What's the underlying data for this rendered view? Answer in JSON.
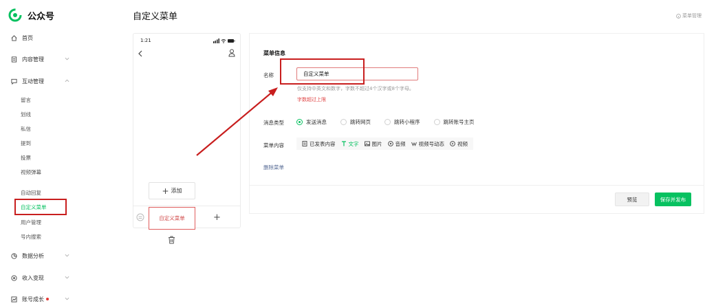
{
  "brand": {
    "name": "公众号",
    "logo_icon": "wechat-official-account-logo"
  },
  "sidebar": {
    "top_items": [
      {
        "label": "首页",
        "icon": "home-icon"
      },
      {
        "label": "内容管理",
        "icon": "document-icon"
      },
      {
        "label": "互动管理",
        "icon": "chat-icon"
      },
      {
        "label": "数据分析",
        "icon": "chart-icon"
      },
      {
        "label": "收入变现",
        "icon": "coin-icon"
      },
      {
        "label": "账号成长",
        "icon": "growth-icon"
      }
    ],
    "interaction_sub_items": [
      "留言",
      "划线",
      "私信",
      "提到",
      "投票",
      "视频弹幕"
    ],
    "service_sub_items": [
      "自动回复",
      "自定义菜单",
      "用户管理",
      "号内搜索"
    ],
    "active_item": "自定义菜单"
  },
  "header": {
    "title": "自定义菜单",
    "top_right_link": "菜单管理"
  },
  "phone": {
    "time": "1:21",
    "add_button_label": "添加",
    "selected_menu_label": "自定义菜单"
  },
  "form": {
    "section_title": "菜单信息",
    "name_label": "名称",
    "name_value": "自定义菜单",
    "name_hint": "仅支持中英文和数字，字数不超过4个汉字或8个字母。",
    "name_error": "字数超过上限",
    "msg_type_label": "消息类型",
    "msg_types": [
      "发送消息",
      "跳转网页",
      "跳转小程序",
      "跳转账号主页"
    ],
    "selected_msg_type": "发送消息",
    "content_label": "菜单内容",
    "content_tabs": [
      "已发表内容",
      "文字",
      "图片",
      "音频",
      "视频号动态",
      "视频"
    ],
    "active_content_tab": "文字",
    "delete_link": "删除菜单",
    "preview_button": "预览",
    "save_button": "保存并发布"
  },
  "colors": {
    "accent": "#07c160",
    "error": "#e04848",
    "annotation": "#c81e1e"
  }
}
